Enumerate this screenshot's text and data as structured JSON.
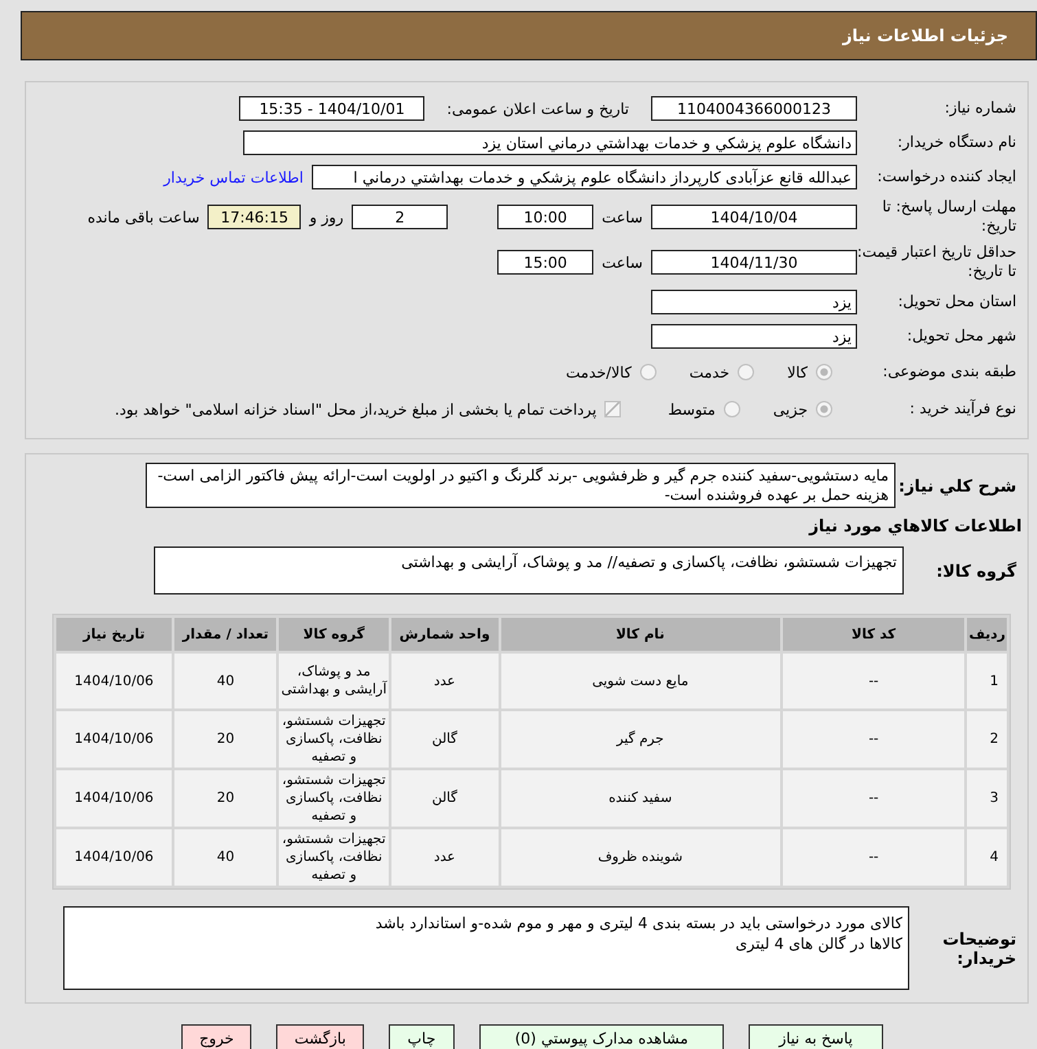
{
  "header": {
    "title": "جزئیات اطلاعات نیاز"
  },
  "need_number": {
    "label": "شماره نیاز:",
    "value": "1104004366000123"
  },
  "announce": {
    "label": "تاریخ و ساعت اعلان عمومی:",
    "value": "1404/10/01 - 15:35"
  },
  "buyer": {
    "label": "نام دستگاه خریدار:",
    "value": "دانشگاه علوم پزشکي و خدمات بهداشتي  درماني استان يزد"
  },
  "requester": {
    "label": "ایجاد کننده درخواست:",
    "value": "عبدالله قانع عزآبادی کارپرداز دانشگاه علوم پزشکي و خدمات بهداشتي  درماني ا",
    "link": "اطلاعات تماس خریدار"
  },
  "deadline": {
    "label": "مهلت ارسال پاسخ: تا تاریخ:",
    "date": "1404/10/04",
    "time_label": "ساعت",
    "time": "10:00",
    "days": "2",
    "days_label": "روز و",
    "remaining": "17:46:15",
    "remaining_label": "ساعت باقی مانده"
  },
  "validity": {
    "label": "حداقل تاریخ اعتبار قیمت: تا تاریخ:",
    "date": "1404/11/30",
    "time_label": "ساعت",
    "time": "15:00"
  },
  "province": {
    "label": "استان محل تحویل:",
    "value": "یزد"
  },
  "city": {
    "label": "شهر محل تحویل:",
    "value": "یزد"
  },
  "category": {
    "label": "طبقه بندی موضوعی:",
    "options": [
      {
        "label": "کالا",
        "selected": true
      },
      {
        "label": "خدمت",
        "selected": false
      },
      {
        "label": "کالا/خدمت",
        "selected": false
      }
    ]
  },
  "process": {
    "label": "نوع فرآیند خرید :",
    "options": [
      {
        "label": "جزیی",
        "selected": true
      },
      {
        "label": "متوسط",
        "selected": false
      }
    ],
    "payment": {
      "label": "پرداخت تمام یا بخشی از مبلغ خرید،از محل \"اسناد خزانه اسلامی\" خواهد بود.",
      "checked": true
    }
  },
  "description": {
    "label": "شرح کلي نیاز:",
    "value": "مایه دستشویی-سفید کننده جرم گیر و ظرفشویی -برند گلرنگ و اکتیو در اولویت است-ارائه پیش فاکتور الزامی است-هزینه حمل بر عهده فروشنده است-"
  },
  "goods_title": "اطلاعات کالاهاي مورد نیاز",
  "goods_group": {
    "label": "گروه کالا:",
    "value": "تجهیزات شستشو، نظافت، پاکسازی و تصفیه// مد و پوشاک، آرایشی و بهداشتی"
  },
  "table": {
    "columns": [
      "ردیف",
      "کد کالا",
      "نام کالا",
      "واحد شمارش",
      "گروه کالا",
      "تعداد / مقدار",
      "تاریخ نیاز"
    ],
    "rows": [
      [
        "1",
        "--",
        "مایع دست شویی",
        "عدد",
        "مد و پوشاک، آرایشی و بهداشتی",
        "40",
        "1404/10/06"
      ],
      [
        "2",
        "--",
        "جرم گیر",
        "گالن",
        "تجهیزات شستشو، نظافت، پاکسازی و تصفیه",
        "20",
        "1404/10/06"
      ],
      [
        "3",
        "--",
        "سفید کننده",
        "گالن",
        "تجهیزات شستشو، نظافت، پاکسازی و تصفیه",
        "20",
        "1404/10/06"
      ],
      [
        "4",
        "--",
        "شوینده ظروف",
        "عدد",
        "تجهیزات شستشو، نظافت، پاکسازی و تصفیه",
        "40",
        "1404/10/06"
      ]
    ]
  },
  "notes": {
    "label": "توضیحات خریدار:",
    "lines": [
      "کالای مورد درخواستی باید در بسته بندی 4 لیتری و مهر و موم شده-و استاندارد باشد",
      "کالاها در گالن های 4 لیتری"
    ]
  },
  "buttons": [
    {
      "label": "پاسخ به نیاز",
      "color": "#e8fde8"
    },
    {
      "label": "مشاهده مدارک پیوستي (0)",
      "color": "#e8fde8"
    },
    {
      "label": "چاپ",
      "color": "#e8fde8"
    },
    {
      "label": "بازگشت",
      "color": "#ffd8d8"
    },
    {
      "label": "خروج",
      "color": "#ffd8d8"
    }
  ]
}
